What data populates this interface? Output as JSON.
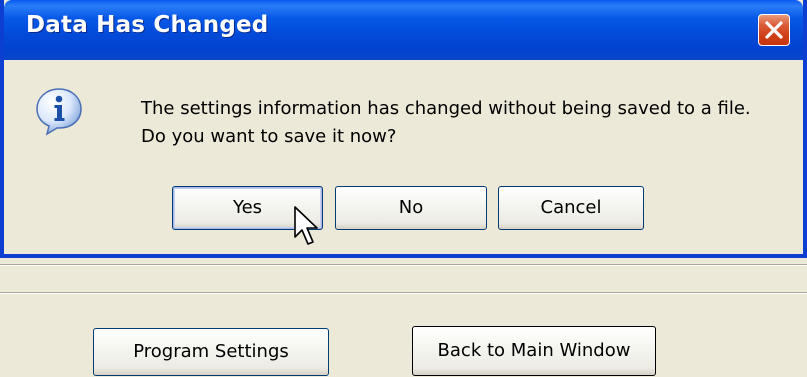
{
  "dialog": {
    "title": "Data Has Changed",
    "message_line1": "The settings information has changed without being saved to a file.",
    "message_line2": "Do you want to save it now?",
    "icon": "information-icon",
    "buttons": {
      "yes": "Yes",
      "no": "No",
      "cancel": "Cancel"
    },
    "default_button": "yes"
  },
  "background_window": {
    "buttons": {
      "program_settings": "Program Settings",
      "back_to_main": "Back to Main Window"
    }
  },
  "colors": {
    "titlebar": "#0349d8",
    "dialog_border": "#0c3fd1",
    "close_button": "#cf3e17",
    "window_background": "#ece9d8",
    "button_border": "#003c74"
  }
}
